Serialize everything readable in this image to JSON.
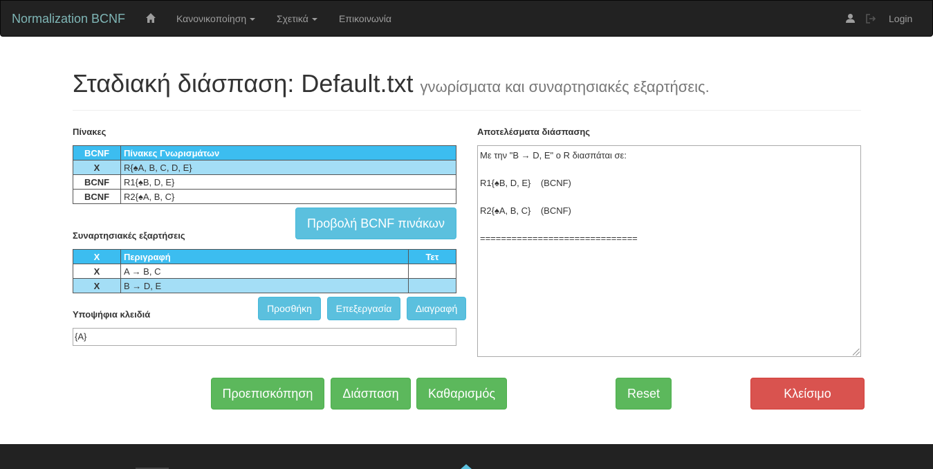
{
  "navbar": {
    "brand": "Normalization BCNF",
    "home_icon": "home-icon",
    "items": [
      {
        "label": "Κανονικοποίηση",
        "dropdown": true
      },
      {
        "label": "Σχετικά",
        "dropdown": true
      },
      {
        "label": "Επικοινωνία",
        "dropdown": false
      }
    ],
    "user_icon": "user-icon",
    "logout_icon": "logout-icon",
    "login": "Login"
  },
  "header": {
    "title": "Σταδιακή διάσπαση: Default.txt",
    "subtitle": "γνωρίσματα και συναρτησιακές εξαρτήσεις."
  },
  "tables_section": {
    "label": "Πίνακες",
    "columns": [
      "BCNF",
      "Πίνακες Γνωρισμάτων"
    ],
    "rows": [
      {
        "bcnf": "X",
        "name": "R{♠A, B, C, D, E}"
      },
      {
        "bcnf": "BCNF",
        "name": "R1{♠B, D, E}"
      },
      {
        "bcnf": "BCNF",
        "name": "R2{♠A, B, C}"
      }
    ],
    "view_button": "Προβολή BCNF πινάκων"
  },
  "fd_section": {
    "label": "Συναρτησιακές εξαρτήσεις",
    "columns": [
      "X",
      "Περιγραφή",
      "Τετ"
    ],
    "rows": [
      {
        "x": "X",
        "desc": "A → B, C",
        "tet": ""
      },
      {
        "x": "X",
        "desc": "B → D, E",
        "tet": ""
      }
    ],
    "buttons": {
      "add": "Προσθήκη",
      "edit": "Επεξεργασία",
      "delete": "Διαγραφή"
    }
  },
  "keys_section": {
    "label": "Υποψήφια κλειδιά",
    "value": "{A}"
  },
  "results_section": {
    "label": "Αποτελέσματα διάσπασης",
    "lines": [
      "Με την \"B → D, E\" ο R διασπάται σε:",
      "",
      "R1{♠B, D, E}    (BCNF)",
      "",
      "R2{♠A, B, C}    (BCNF)",
      "",
      "=============================="
    ]
  },
  "actions": {
    "preview": "Προεπισκόπηση",
    "decompose": "Διάσπαση",
    "clear": "Καθαρισμός",
    "reset": "Reset",
    "close": "Κλείσιμο"
  },
  "colors": {
    "navbar": "#222222",
    "table_header": "#3cbdf0",
    "row_highlight": "#a4def6",
    "info": "#5bc0de",
    "success": "#5cb85c",
    "danger": "#d9534f"
  }
}
